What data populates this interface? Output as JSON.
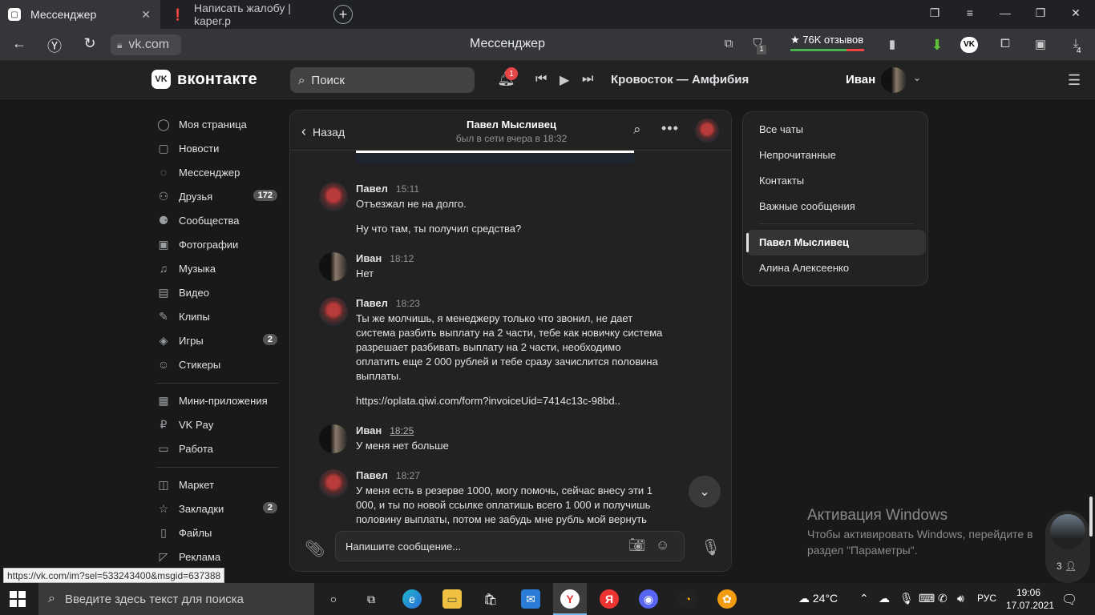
{
  "browser": {
    "tabs": [
      {
        "label": "Мессенджер",
        "active": true
      },
      {
        "label": "Написать жалобу | kaper.p",
        "active": false
      }
    ],
    "url": "vk.com",
    "page_title": "Мессенджер",
    "reviews_label": "★ 76K отзывов",
    "badge_count": "1",
    "downloads_count": "4"
  },
  "vk_header": {
    "logo_text": "вконтакте",
    "search_placeholder": "Поиск",
    "notifications_count": "1",
    "now_playing": "Кровосток — Амфибия",
    "user_name": "Иван"
  },
  "menu": {
    "group1": [
      {
        "label": "Моя страница",
        "icon": "user-circle-icon",
        "count": ""
      },
      {
        "label": "Новости",
        "icon": "news-icon",
        "count": ""
      },
      {
        "label": "Мессенджер",
        "icon": "message-icon",
        "count": ""
      },
      {
        "label": "Друзья",
        "icon": "friends-icon",
        "count": "172"
      },
      {
        "label": "Сообщества",
        "icon": "communities-icon",
        "count": ""
      },
      {
        "label": "Фотографии",
        "icon": "photo-icon",
        "count": ""
      },
      {
        "label": "Музыка",
        "icon": "music-icon",
        "count": ""
      },
      {
        "label": "Видео",
        "icon": "video-icon",
        "count": ""
      },
      {
        "label": "Клипы",
        "icon": "clips-icon",
        "count": ""
      },
      {
        "label": "Игры",
        "icon": "games-icon",
        "count": "2"
      },
      {
        "label": "Стикеры",
        "icon": "sticker-icon",
        "count": ""
      }
    ],
    "group2": [
      {
        "label": "Мини-приложения",
        "icon": "apps-icon",
        "count": ""
      },
      {
        "label": "VK Pay",
        "icon": "vkpay-icon",
        "count": ""
      },
      {
        "label": "Работа",
        "icon": "work-icon",
        "count": ""
      }
    ],
    "group3": [
      {
        "label": "Маркет",
        "icon": "market-icon",
        "count": ""
      },
      {
        "label": "Закладки",
        "icon": "star-icon",
        "count": "2"
      },
      {
        "label": "Файлы",
        "icon": "file-icon",
        "count": ""
      },
      {
        "label": "Реклама",
        "icon": "ads-icon",
        "count": ""
      }
    ]
  },
  "chat": {
    "back_label": "Назад",
    "contact_name": "Павел Мысливец",
    "contact_status": "был в сети вчера в 18:32",
    "messages": [
      {
        "author": "Павел",
        "time": "15:11",
        "lines": [
          "Отъезжал не на долго.",
          "",
          "Ну что там, ты получил средства?"
        ]
      },
      {
        "author": "Иван",
        "time": "18:12",
        "lines": [
          "Нет"
        ]
      },
      {
        "author": "Павел",
        "time": "18:23",
        "lines": [
          "Ты же молчишь, я менеджеру только что звонил, не дает система разбить выплату на 2 части, тебе как новичку система разрешает разбивать выплату на 2 части, необходимо оплатить еще 2 000 рублей и тебе сразу зачислится половина выплаты.",
          "",
          "https://oplata.qiwi.com/form?invoiceUid=7414c13c-98bd.."
        ]
      },
      {
        "author": "Иван",
        "time": "18:25",
        "lines": [
          "У меня нет больше"
        ]
      },
      {
        "author": "Павел",
        "time": "18:27",
        "lines": [
          "У меня есть в резерве 1000, могу помочь, сейчас внесу эти 1 000, и ты по новой ссылке оплатишь всего 1 000 и получишь половину выплаты, потом не забудь мне рубль мой вернуть"
        ]
      }
    ],
    "input_placeholder": "Напишите сообщение..."
  },
  "filters": {
    "items": [
      "Все чаты",
      "Непрочитанные",
      "Контакты",
      "Важные сообщения"
    ],
    "chats": [
      "Павел Мысливец",
      "Алина Алексеенко"
    ],
    "selected": "Павел Мысливец"
  },
  "windows": {
    "activation_title": "Активация Windows",
    "activation_text": "Чтобы активировать Windows, перейдите в раздел \"Параметры\".",
    "side_count": "3",
    "status_url": "https://vk.com/im?sel=533243400&msgid=637388",
    "taskbar_search": "Введите здесь текст для поиска",
    "weather": "24°C",
    "lang": "РУС",
    "time": "19:06",
    "date": "17.07.2021"
  }
}
